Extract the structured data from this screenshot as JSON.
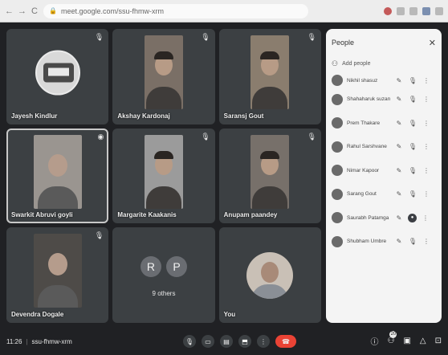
{
  "browser": {
    "url": "meet.google.com/ssu-fhmw-xrm",
    "lock_icon": "lock-icon"
  },
  "tiles": [
    {
      "name": "Jayesh Kindlur",
      "kind": "avatar"
    },
    {
      "name": "Akshay Kardonaj",
      "kind": "video"
    },
    {
      "name": "Saransj Gout",
      "kind": "video"
    },
    {
      "name": "Swarkit Abruvi goyli",
      "kind": "video",
      "active": true
    },
    {
      "name": "Margarite Kaakanis",
      "kind": "video"
    },
    {
      "name": "Anupam paandey",
      "kind": "video"
    },
    {
      "name": "Devendra Dogale",
      "kind": "video"
    },
    {
      "name": "",
      "kind": "others",
      "initials": [
        "R",
        "P"
      ],
      "others_label": "9 others"
    },
    {
      "name": "You",
      "kind": "self"
    }
  ],
  "people_panel": {
    "title": "People",
    "add_people": "Add people",
    "participants": [
      {
        "name": "Nikhil shasuz"
      },
      {
        "name": "Shahaharuk suzan"
      },
      {
        "name": "Prem Thakare"
      },
      {
        "name": "Rahul Sarshvane"
      },
      {
        "name": "Nimar Kapoor"
      },
      {
        "name": "Sarang Gout"
      },
      {
        "name": "Saurabh Patamga"
      },
      {
        "name": "Shubham Umbre"
      }
    ]
  },
  "bottom": {
    "time": "11:26",
    "separator": "|",
    "meeting_code": "ssu-fhmw-xrm",
    "participant_count": "20"
  },
  "colors": {
    "stage": "#202124",
    "tile": "#3c4043",
    "end_call": "#ea4335",
    "panel": "#f4f4f4"
  }
}
